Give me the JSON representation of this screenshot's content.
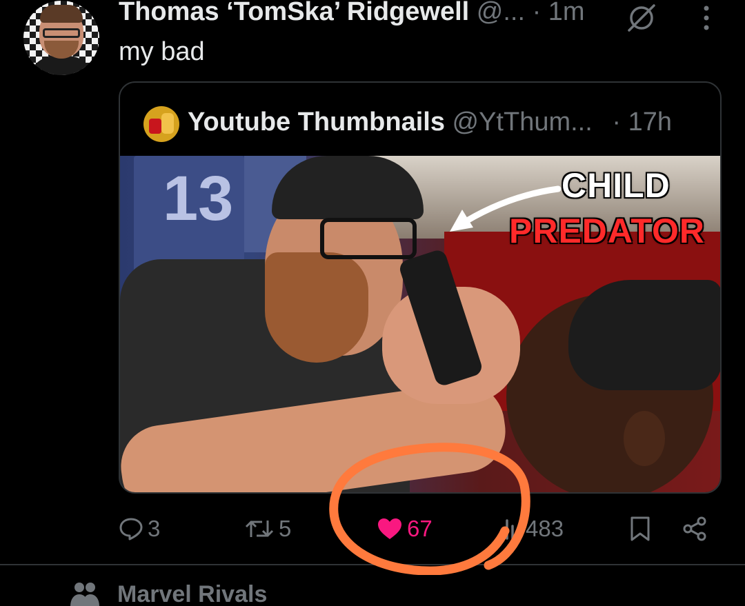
{
  "tweet": {
    "author_name": "Thomas ‘TomSka’ Ridgewell",
    "handle": "@...",
    "separator": "·",
    "time": "1m",
    "text": "my bad"
  },
  "quote": {
    "name": "Youtube Thumbnails",
    "handle": "@YtThum...",
    "time": "· 17h",
    "thumbnail_caption_line1": "CHILD",
    "thumbnail_caption_line2": "PREDATOR",
    "thumbnail_jersey_number": "13"
  },
  "actions": {
    "replies": "3",
    "reposts": "5",
    "likes": "67",
    "views": "483"
  },
  "next": {
    "label": "Marvel Rivals"
  },
  "colors": {
    "background": "#000000",
    "text": "#e7e9ea",
    "muted": "#71767b",
    "like": "#f91880",
    "annotation_circle": "#ff7a3d"
  }
}
